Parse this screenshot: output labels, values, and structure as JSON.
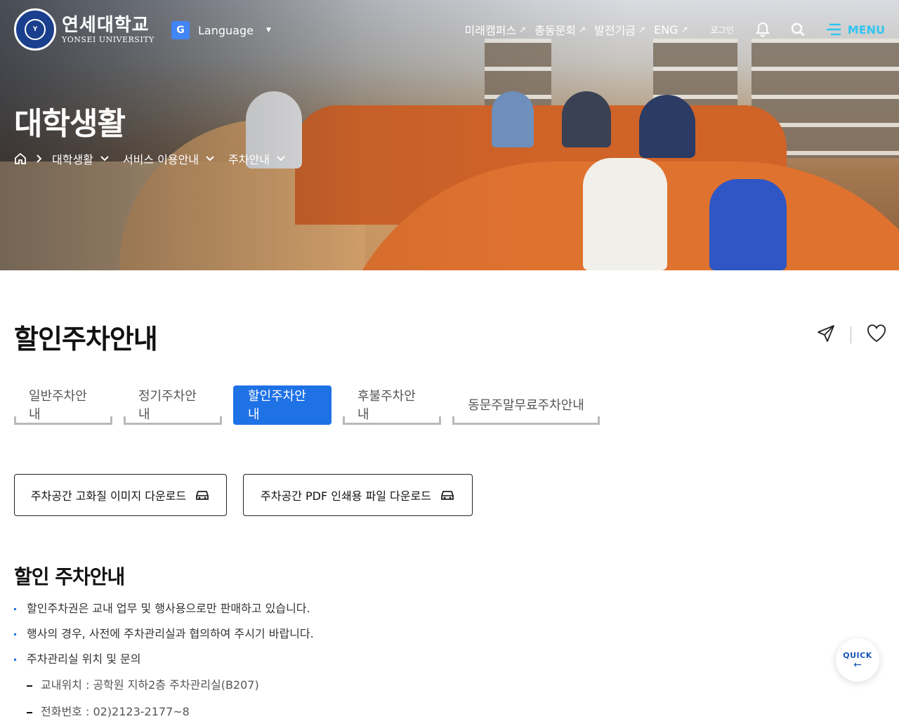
{
  "header": {
    "logo_ko": "연세대학교",
    "logo_en": "YONSEI UNIVERSITY",
    "language_label": "Language",
    "links": [
      "미래캠퍼스",
      "총동문회",
      "발전기금",
      "ENG"
    ],
    "login_label": "로그인",
    "menu_label": "MENU"
  },
  "hero": {
    "title": "대학생활",
    "breadcrumb": [
      "대학생활",
      "서비스 이용안내",
      "주차안내"
    ]
  },
  "page": {
    "title": "할인주차안내"
  },
  "tabs": [
    {
      "label": "일반주차안내",
      "active": false
    },
    {
      "label": "정기주차안내",
      "active": false
    },
    {
      "label": "할인주차안내",
      "active": true
    },
    {
      "label": "후불주차안내",
      "active": false
    },
    {
      "label": "동문주말무료주차안내",
      "active": false
    }
  ],
  "downloads": {
    "image_label": "주차공간 고화질 이미지 다운로드",
    "pdf_label": "주차공간 PDF 인쇄용 파일 다운로드"
  },
  "section": {
    "title": "할인 주차안내",
    "bullets": [
      "할인주차권은 교내 업무 및 행사용으로만 판매하고 있습니다.",
      "행사의 경우, 사전에 주차관리실과 협의하여 주시기 바랍니다.",
      "주차관리실 위치 및 문의"
    ],
    "subs": [
      "교내위치 : 공학원 지하2층 주차관리실(B207)",
      "전화번호 : 02)2123-2177~8"
    ]
  },
  "quick": {
    "label": "QUICK",
    "arrow": "←"
  },
  "colors": {
    "accent": "#1e72e6",
    "menu": "#32c4f0"
  }
}
